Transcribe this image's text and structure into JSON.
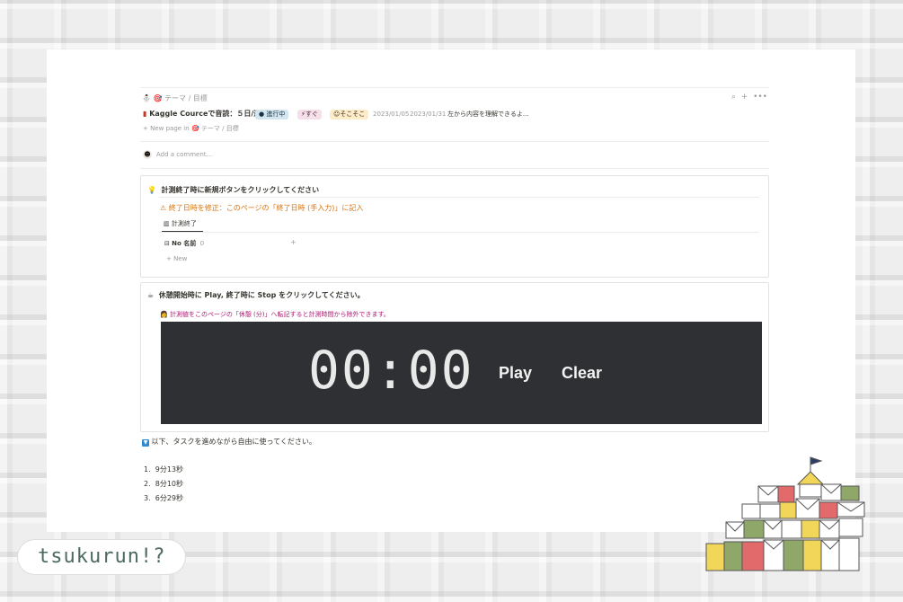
{
  "breadcrumb": {
    "path": "テーマ / 目標"
  },
  "topbar": {
    "search_icon": "search-icon",
    "add_icon": "plus-icon",
    "more_icon": "more-icon"
  },
  "row": {
    "title": "Kaggle Courceで音読：５日/週",
    "status": "進行中",
    "priority": "すぐ",
    "effort": "そこそこ",
    "start_date": "2023/01/05",
    "end_date": "2023/01/31",
    "note": "左から内容を理解できるよ..."
  },
  "new_page": {
    "label": "New page in",
    "target": "テーマ / 目標"
  },
  "comment": {
    "placeholder": "Add a comment..."
  },
  "callout1": {
    "title": "計測終了時に新規ボタンをクリックしてください",
    "warning": "⚠ 終了日時を修正：このページの「終了日時 (手入力)」に記入",
    "view_tab": "計測終了",
    "group_label": "No 名前",
    "group_count": "0",
    "add_label": "+",
    "new_label": "New"
  },
  "callout2": {
    "title": "休憩開始時に Play, 終了時に Stop をクリックしてください。",
    "info": "計測値をこのページの「休憩 (分)」へ転記すると計測時間から除外できます。"
  },
  "timer": {
    "display": "00:00",
    "play_label": "Play",
    "clear_label": "Clear"
  },
  "note_text": "以下、タスクを進めながら自由に使ってください。",
  "list": {
    "items": [
      {
        "num": "1.",
        "text": "9分13秒"
      },
      {
        "num": "2.",
        "text": "8分10秒"
      },
      {
        "num": "3.",
        "text": "6分29秒"
      }
    ]
  },
  "logo": {
    "text": "tsukurun!?"
  },
  "colors": {
    "timer_bg": "#2f3033",
    "warning": "#d9730d",
    "info": "#ad1a72",
    "status_bg": "#d3e5ef",
    "priority_bg": "#f5e0e9",
    "effort_bg": "#fdecc8"
  }
}
